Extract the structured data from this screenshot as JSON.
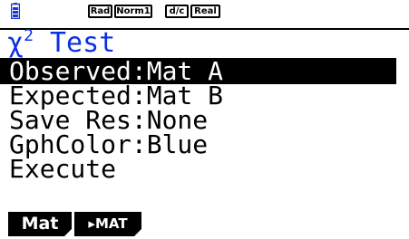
{
  "status_bar": {
    "battery_icon": "battery-icon",
    "angle_mode": "Rad",
    "display_mode": "Norm1",
    "fraction_mode": "d/c",
    "complex_mode": "Real"
  },
  "title": {
    "chi": "χ",
    "superscript": "2",
    "text": " Test"
  },
  "settings": {
    "observed": "Observed:Mat A",
    "expected": "Expected:Mat B",
    "save_res": "Save Res:None",
    "graph_color": "GphColor:Blue",
    "execute": "Execute"
  },
  "function_keys": {
    "f1": "Mat",
    "f2": "▸MAT"
  },
  "colors": {
    "title": "#0b2fe8",
    "highlight_bg": "#000000",
    "highlight_fg": "#ffffff",
    "background": "#ffffff"
  }
}
